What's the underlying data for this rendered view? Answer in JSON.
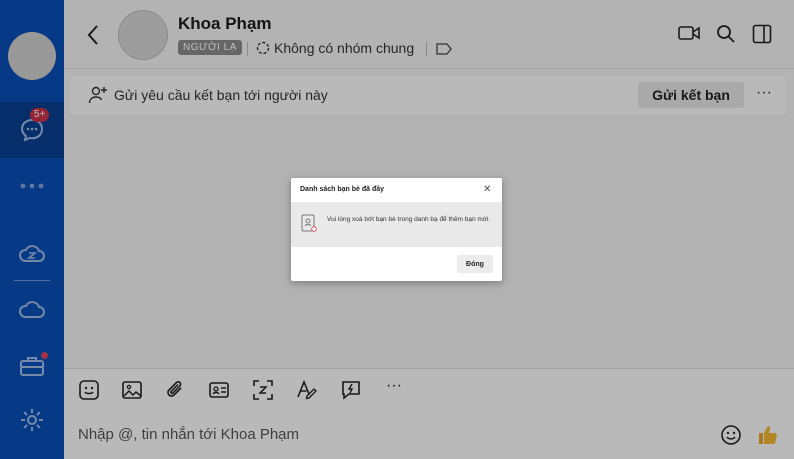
{
  "sidebar": {
    "messages_badge": "5+"
  },
  "header": {
    "name": "Khoa Phạm",
    "tag": "NGƯỜI LẠ",
    "groups_text": "Không có nhóm chung"
  },
  "friend_bar": {
    "text": "Gửi yêu cầu kết bạn tới người này",
    "button": "Gửi kết bạn",
    "more": "···"
  },
  "composer": {
    "placeholder": "Nhập @, tin nhắn tới Khoa Phạm",
    "more": "···"
  },
  "dialog": {
    "title": "Danh sách bạn bè đã đầy",
    "close": "✕",
    "message": "Vui lòng xoá bớt bạn bè trong danh bạ để thêm bạn mới.",
    "button": "Đóng"
  },
  "colors": {
    "sidebar": "#0a4fb5",
    "badge": "#c9324a"
  }
}
